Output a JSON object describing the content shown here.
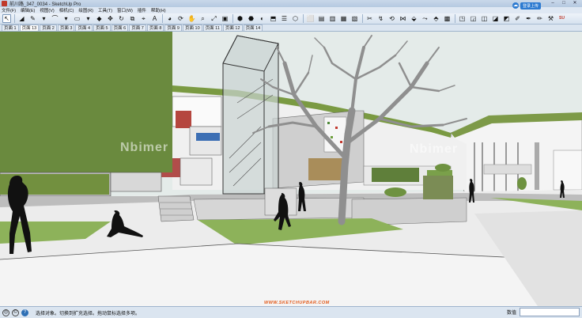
{
  "window": {
    "title": "前川路_347_0034 - SketchUp Pro",
    "controls": [
      "–",
      "□",
      "✕"
    ]
  },
  "login": {
    "label": "登录上传"
  },
  "menu": [
    "文件(F)",
    "编辑(E)",
    "视图(V)",
    "相机(C)",
    "绘图(R)",
    "工具(T)",
    "窗口(W)",
    "插件",
    "帮助(H)"
  ],
  "toolbar": {
    "tools": [
      {
        "name": "select-tool-icon",
        "glyph": "↖",
        "selected": true
      },
      {
        "name": "eraser-tool-icon",
        "glyph": "◢"
      },
      {
        "name": "pencil-tool-icon",
        "glyph": "✎"
      },
      {
        "name": "line-dropdown-icon",
        "glyph": "▾"
      },
      {
        "name": "arc-tool-icon",
        "glyph": "⌒"
      },
      {
        "name": "arc-dropdown-icon",
        "glyph": "▾"
      },
      {
        "name": "rectangle-tool-icon",
        "glyph": "▭"
      },
      {
        "name": "rect-dropdown-icon",
        "glyph": "▾"
      },
      {
        "name": "push-pull-tool-icon",
        "glyph": "◆"
      },
      {
        "name": "move-tool-icon",
        "glyph": "✥"
      },
      {
        "name": "rotate-tool-icon",
        "glyph": "↻"
      },
      {
        "name": "scale-tool-icon",
        "glyph": "⧉"
      },
      {
        "name": "tape-measure-icon",
        "glyph": "⌖"
      },
      {
        "name": "text-tool-icon",
        "glyph": "A"
      },
      {
        "name": "paint-bucket-icon",
        "glyph": "◕"
      },
      {
        "name": "orbit-tool-icon",
        "glyph": "⟳"
      },
      {
        "name": "pan-tool-icon",
        "glyph": "✋"
      },
      {
        "name": "zoom-tool-icon",
        "glyph": "⌕"
      },
      {
        "name": "zoom-extents-icon",
        "glyph": "⤢"
      },
      {
        "name": "materials-icon",
        "glyph": "▣"
      },
      {
        "name": "warehouse-icon",
        "glyph": "⬢"
      },
      {
        "name": "components-icon",
        "glyph": "⬣"
      },
      {
        "name": "styles-icon",
        "glyph": "◐"
      },
      {
        "name": "section-plane-icon",
        "glyph": "⬒"
      },
      {
        "name": "layers-icon",
        "glyph": "☰"
      },
      {
        "name": "iso-view-icon",
        "glyph": "⬡"
      },
      {
        "name": "top-view-icon",
        "glyph": "⬜"
      },
      {
        "name": "front-view-icon",
        "glyph": "▤"
      },
      {
        "name": "right-view-icon",
        "glyph": "▥"
      },
      {
        "name": "back-view-icon",
        "glyph": "▦"
      },
      {
        "name": "left-view-icon",
        "glyph": "▧"
      },
      {
        "name": "sandbox-icon",
        "glyph": "✂"
      },
      {
        "name": "follow-me-icon",
        "glyph": "↯"
      },
      {
        "name": "offset-icon",
        "glyph": "⟲"
      },
      {
        "name": "intersect-icon",
        "glyph": "⋈"
      },
      {
        "name": "outer-shell-icon",
        "glyph": "⬙"
      },
      {
        "name": "soften-edges-icon",
        "glyph": "⤳"
      },
      {
        "name": "solid-tools-icon",
        "glyph": "⬘"
      },
      {
        "name": "photo-match-icon",
        "glyph": "▩"
      },
      {
        "name": "xray-icon",
        "glyph": "◳"
      },
      {
        "name": "back-edges-icon",
        "glyph": "◲"
      },
      {
        "name": "wireframe-icon",
        "glyph": "◫"
      },
      {
        "name": "hidden-line-icon",
        "glyph": "◪"
      },
      {
        "name": "shaded-icon",
        "glyph": "◩"
      },
      {
        "name": "textured-icon",
        "glyph": "✐"
      },
      {
        "name": "monochrome-icon",
        "glyph": "✒"
      },
      {
        "name": "shadows-icon",
        "glyph": "✏"
      },
      {
        "name": "fog-icon",
        "glyph": "⚒"
      },
      {
        "name": "plugin-su-icon",
        "glyph": "SU"
      }
    ]
  },
  "scenes": [
    "页面 1",
    "页面 13",
    "页面 2",
    "页面 3",
    "页面 4",
    "页面 5",
    "页面 6",
    "页面 7",
    "页面 8",
    "页面 9",
    "页面 10",
    "页面 11",
    "页面 12",
    "页面 14"
  ],
  "active_scene": 1,
  "watermark": {
    "left": "Nbimer",
    "right": "Nbimer",
    "site": "WWW.SKETCHUPBAR.COM"
  },
  "status": {
    "message": "选择对象。切换到扩充选择。拖动鼠标选择多项。",
    "measure_label": "数值",
    "measure_value": ""
  },
  "colors": {
    "grass_wall": "#6a8a3e",
    "sky": "#e4ebe9",
    "ground": "#ececec",
    "lawn": "#8db25a"
  }
}
